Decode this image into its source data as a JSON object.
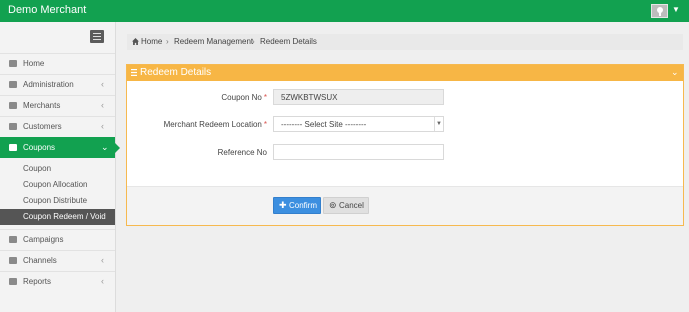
{
  "header": {
    "brand": "Demo Merchant"
  },
  "sidebar": {
    "items": [
      {
        "label": "Home",
        "icon": "home-icon"
      },
      {
        "label": "Administration",
        "icon": "users-icon"
      },
      {
        "label": "Merchants",
        "icon": "store-icon"
      },
      {
        "label": "Customers",
        "icon": "list-icon"
      },
      {
        "label": "Coupons",
        "icon": "ticket-icon"
      },
      {
        "label": "Campaigns",
        "icon": "users-icon"
      },
      {
        "label": "Channels",
        "icon": "users-icon"
      },
      {
        "label": "Reports",
        "icon": "cart-icon"
      }
    ],
    "coupon_subitems": [
      {
        "label": "Coupon"
      },
      {
        "label": "Coupon Allocation"
      },
      {
        "label": "Coupon Distribute"
      },
      {
        "label": "Coupon Redeem / Void"
      }
    ]
  },
  "breadcrumb": {
    "items": [
      "Home",
      "Redeem Management",
      "Redeem Details"
    ]
  },
  "panel": {
    "title": "Redeem Details"
  },
  "form": {
    "coupon_no_label": "Coupon No",
    "coupon_no_value": "5ZWKBTWSUX",
    "location_label": "Merchant Redeem Location",
    "location_value": "-------- Select Site --------",
    "reference_label": "Reference No",
    "reference_value": "",
    "required_mark": "*",
    "confirm_label": "Confirm",
    "cancel_label": "Cancel"
  },
  "colors": {
    "header_green": "#12a150",
    "panel_orange": "#f7b645",
    "confirm_blue": "#3c8fe0"
  }
}
